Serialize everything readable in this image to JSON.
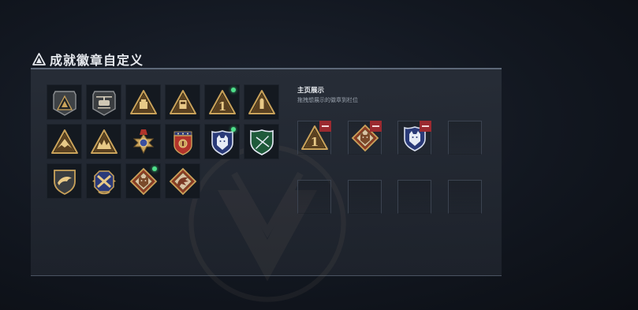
{
  "title": "成就徽章自定义",
  "colors": {
    "accent_dot": "#4ee08a",
    "remove": "#9b2a30",
    "panel_border": "#5d6878"
  },
  "collection": [
    {
      "name": "mountain-triangle-badge-icon",
      "new": false
    },
    {
      "name": "helicopter-badge-icon",
      "new": false
    },
    {
      "name": "tank-triangle-badge-icon",
      "new": false
    },
    {
      "name": "ammo-triangle-badge-icon",
      "new": false
    },
    {
      "name": "rank-one-triangle-badge-icon",
      "new": true
    },
    {
      "name": "bullet-triangle-badge-icon",
      "new": false
    },
    {
      "name": "eagle-triangle-badge-icon",
      "new": false
    },
    {
      "name": "fortress-triangle-badge-icon",
      "new": false
    },
    {
      "name": "cross-medal-badge-icon",
      "new": false
    },
    {
      "name": "star-shield-badge-icon",
      "new": false
    },
    {
      "name": "wolf-shield-badge-icon",
      "new": true
    },
    {
      "name": "green-rifle-shield-badge-icon",
      "new": false
    },
    {
      "name": "dolphin-shield-badge-icon",
      "new": false
    },
    {
      "name": "winged-cross-badge-icon",
      "new": false
    },
    {
      "name": "wolf-diamond-badge-icon",
      "new": true
    },
    {
      "name": "dragon-diamond-badge-icon",
      "new": false
    }
  ],
  "showcase": {
    "heading": "主页展示",
    "subheading": "拖拽想展示的徽章到栏位",
    "slots": [
      {
        "name": "rank-one-triangle-badge-icon",
        "filled": true
      },
      {
        "name": "wolf-diamond-badge-icon",
        "filled": true
      },
      {
        "name": "wolf-shield-badge-icon",
        "filled": true
      },
      {
        "filled": false
      },
      {
        "filled": false
      },
      {
        "filled": false
      },
      {
        "filled": false
      },
      {
        "filled": false
      }
    ]
  }
}
